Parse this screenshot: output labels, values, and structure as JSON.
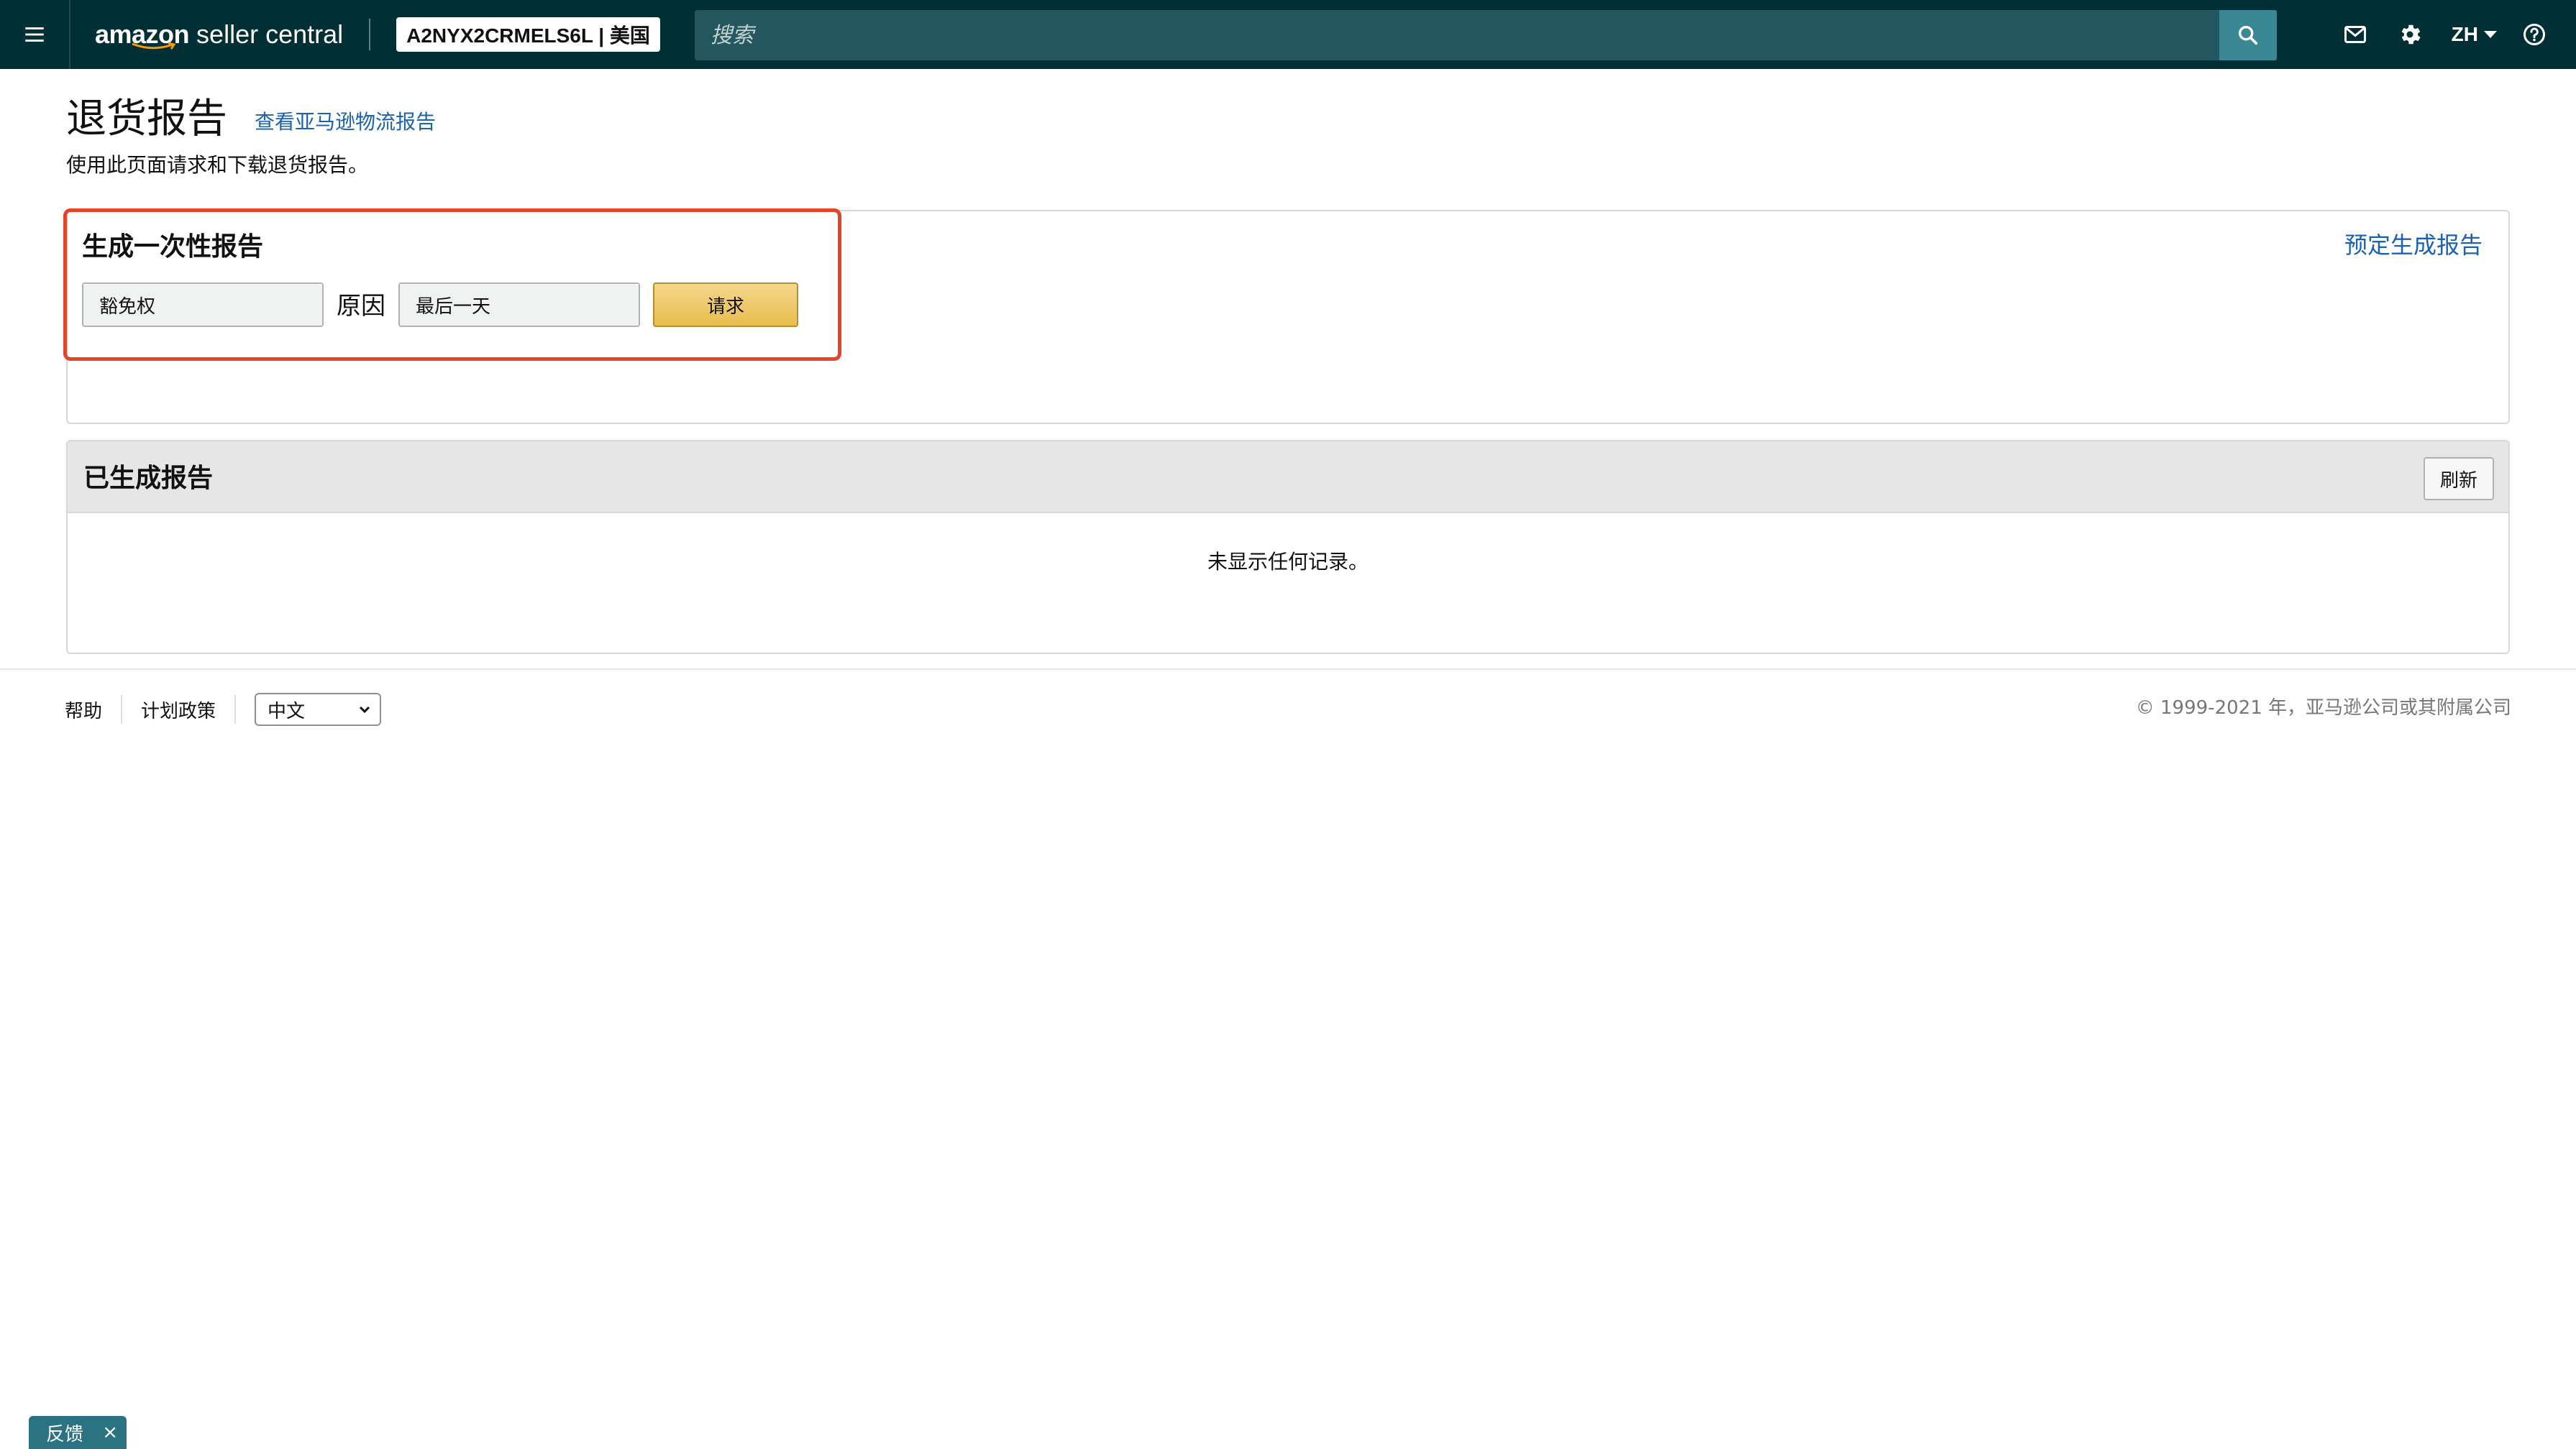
{
  "topbar": {
    "logo_brand": "amazon",
    "logo_rest": "seller central",
    "account": "A2NYX2CRMELS6L | 美国",
    "search_placeholder": "搜索",
    "language": "ZH",
    "icons": [
      "menu-icon",
      "search-icon",
      "mail-icon",
      "gear-icon",
      "help-icon"
    ]
  },
  "header": {
    "title": "退货报告",
    "fba_link": "查看亚马逊物流报告",
    "description": "使用此页面请求和下载退货报告。"
  },
  "generate": {
    "title": "生成一次性报告",
    "schedule_link": "预定生成报告",
    "type_value": "豁免权",
    "reason_label": "原因",
    "range_value": "最后一天",
    "request_label": "请求"
  },
  "reports": {
    "title": "已生成报告",
    "refresh_label": "刷新",
    "empty_text": "未显示任何记录。"
  },
  "footer": {
    "help": "帮助",
    "policy": "计划政策",
    "language_value": "中文",
    "copyright": "© 1999-2021 年，亚马逊公司或其附属公司"
  },
  "feedback": {
    "label": "反馈",
    "close": "×"
  },
  "colors": {
    "topbar": "#002f36",
    "link": "#1a62b3",
    "highlight": "#e2452a",
    "request_button": "#f0c14b"
  }
}
